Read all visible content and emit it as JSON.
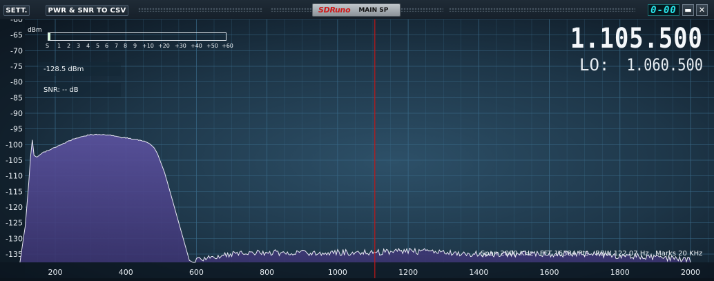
{
  "titlebar": {
    "sett_label": "SETT.",
    "pwr_snr_label": "PWR & SNR TO CSV",
    "logo": "SDRuno",
    "window_title": "MAIN SP",
    "clock": "0-00",
    "minimize_glyph": "▬",
    "close_glyph": "✕"
  },
  "smeter": {
    "unit_label": "dBm",
    "scale": [
      "S",
      "1",
      "2",
      "3",
      "4",
      "5",
      "6",
      "7",
      "8",
      "9",
      "+10",
      "+20",
      "+30",
      "+40",
      "+50",
      "+60"
    ],
    "level_fraction": 0.01
  },
  "readouts": {
    "power": "-128.5 dBm",
    "snr": "SNR: -- dB",
    "frequency": "1.105.500",
    "lo_label": "LO:",
    "lo_value": "1.060.500"
  },
  "status_line": "Span 2000 KHz   FFT 16384 Pts   RBW 122.07 Hz   Marks 20 KHz",
  "colors": {
    "background_center": "#2d5068",
    "background_edge": "#0c1620",
    "spectrum_fill": "#554b8a",
    "spectrum_line": "#e8e8f2",
    "cursor_line": "#c01818",
    "grid": "#3a6a88"
  },
  "chart_data": {
    "type": "area",
    "title": "",
    "xlabel": "",
    "ylabel": "dBm",
    "xlim": [
      100,
      2060
    ],
    "ylim": [
      -139,
      -60
    ],
    "x_ticks": [
      200,
      400,
      600,
      800,
      1000,
      1200,
      1400,
      1600,
      1800,
      2000
    ],
    "y_ticks": [
      -60,
      -65,
      -70,
      -75,
      -80,
      -85,
      -90,
      -95,
      -100,
      -105,
      -110,
      -115,
      -120,
      -125,
      -130,
      -135
    ],
    "grid": true,
    "cursor_x": 1105.5,
    "series": [
      {
        "x": [
          100,
          115,
          125,
          130,
          135,
          140,
          148,
          160,
          180,
          200,
          220,
          250,
          280,
          300,
          320,
          340,
          360,
          380,
          400,
          420,
          440,
          460,
          470,
          480,
          490,
          500,
          510,
          520,
          530,
          540,
          550,
          560,
          570,
          580,
          590,
          600,
          650,
          700,
          800,
          900,
          1000,
          1100,
          1200,
          1300,
          1400,
          1500,
          1600,
          1700,
          1800,
          1900,
          2000
        ],
        "values": [
          -141,
          -126,
          -112,
          -104,
          -98.5,
          -103.5,
          -104,
          -103,
          -102,
          -101,
          -100,
          -98.5,
          -97.5,
          -97,
          -97,
          -97,
          -97.3,
          -97.8,
          -98,
          -98.5,
          -98.7,
          -99.5,
          -100,
          -101,
          -103,
          -106,
          -109,
          -113,
          -117,
          -121,
          -125,
          -129,
          -133,
          -137,
          -139,
          -139,
          -137,
          -136,
          -135.5,
          -135.5,
          -135.5,
          -135.5,
          -135,
          -135.5,
          -136,
          -136,
          -136,
          -136,
          -136.5,
          -137,
          -139
        ]
      }
    ]
  }
}
